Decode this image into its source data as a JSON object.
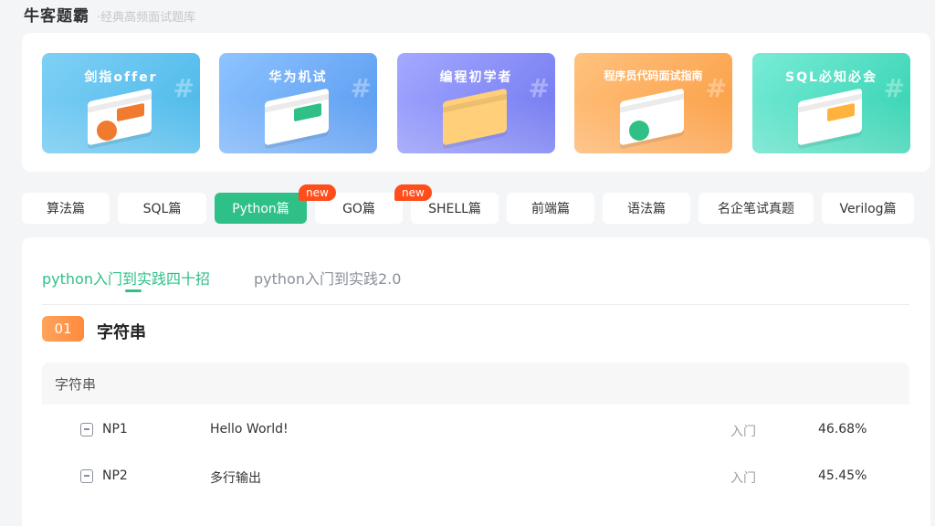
{
  "header": {
    "brand": "牛客题霸",
    "slogan": "·经典高频面试题库"
  },
  "banners": [
    {
      "title": "剑指offer",
      "accent": "#46b6e9",
      "badge": "#f07a2e"
    },
    {
      "title": "华为机试",
      "accent": "#5496ef",
      "badge": "#2fc087"
    },
    {
      "title": "编程初学者",
      "accent": "#6d74ef",
      "badge": "#ffb23e"
    },
    {
      "title": "程序员代码面试指南",
      "accent": "#fb9a3e",
      "badge": "#2fc087"
    },
    {
      "title": "SQL必知必会",
      "accent": "#2ed0ae",
      "badge": "#ffb23e"
    }
  ],
  "categories": [
    {
      "label": "算法篇"
    },
    {
      "label": "SQL篇"
    },
    {
      "label": "Python篇",
      "active": true,
      "badge": "new"
    },
    {
      "label": "GO篇"
    },
    {
      "label": "SHELL篇",
      "badge": "new"
    },
    {
      "label": "前端篇"
    },
    {
      "label": "语法篇"
    },
    {
      "label": "名企笔试真题"
    },
    {
      "label": "Verilog篇"
    }
  ],
  "subtabs": [
    {
      "label": "python入门到实践四十招",
      "active": true
    },
    {
      "label": "python入门到实践2.0"
    }
  ],
  "section": {
    "number": "01",
    "title": "字符串"
  },
  "group": {
    "title": "字符串"
  },
  "questions": [
    {
      "id": "NP1",
      "name": "Hello World!",
      "level": "入门",
      "rate": "46.68%"
    },
    {
      "id": "NP2",
      "name": "多行输出",
      "level": "入门",
      "rate": "45.45%"
    }
  ]
}
